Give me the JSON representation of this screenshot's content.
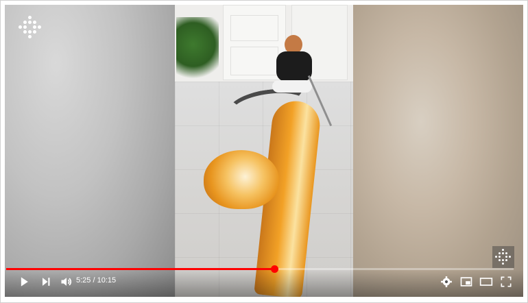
{
  "player": {
    "time_current": "5:25",
    "time_separator": " / ",
    "time_total": "10:15",
    "progress_fraction": 0.529,
    "accent_color": "#ff0000"
  },
  "icons": {
    "play": "play-icon",
    "next": "next-icon",
    "volume": "volume-icon",
    "settings": "gear-icon",
    "miniplayer": "miniplayer-icon",
    "theater": "theater-mode-icon",
    "fullscreen": "fullscreen-icon",
    "logo": "channel-logo-icon"
  }
}
